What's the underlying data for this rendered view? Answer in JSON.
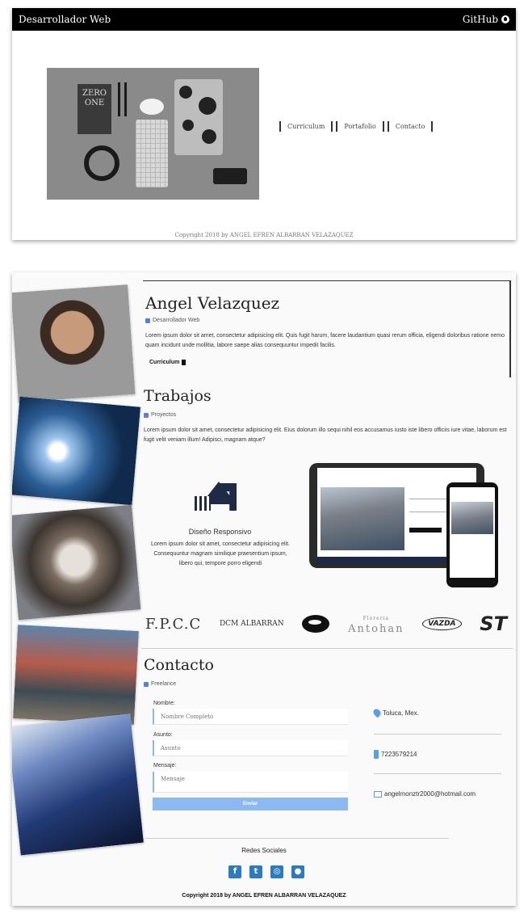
{
  "card1": {
    "brand": "Desarrollador Web",
    "github_label": "GitHub",
    "menu": [
      "Curriculum",
      "Portafolio",
      "Contacto"
    ],
    "hero_book_text": "ZERO\nONE",
    "copyright": "Copyright 2018 by ANGEL EFREN ALBARRAN VELAZAQUEZ"
  },
  "profile": {
    "name": "Angel Velazquez",
    "role": "Desarrollador Web",
    "bio": "Lorem ipsum dolor sit amet, consectetur adipisicing elit. Quis fugit harum, facere laudantium quasi rerum officia, eligendi doloribus ratione nemo quam incidunt unde mollitia, labore saepe alias consequuntur impedit facilis.",
    "cv_label": "Curriculum"
  },
  "work": {
    "title": "Trabajos",
    "subtitle": "Proyectos",
    "text": "Lorem ipsum dolor sit amet, consectetur adipisicing elit. Eius dolorum illo sequi nihil eos accusamus iusto iste libero officiis iure vitae, laborum est fugit velit veniam illum! Adipisci, magnam atque?",
    "feature_title": "Diseño Responsivo",
    "feature_text": "Lorem ipsum dolor sit amet, consectetur adipisicing elit. Consequuntur magnam similique praesentium ipsum, libero qui, tempore porro eligendi",
    "clients": [
      "F.P.C.C",
      "DCM ALBARRAN",
      "",
      "Antohan",
      "VAZDA",
      "ST"
    ],
    "client4_small": "Floreria"
  },
  "contact": {
    "title": "Contacto",
    "subtitle": "Freelance",
    "name_label": "Nombre:",
    "name_placeholder": "Nombre Completo",
    "subject_label": "Asunto:",
    "subject_placeholder": "Asunto",
    "message_label": "Mensaje:",
    "message_placeholder": "Mensaje",
    "send_label": "Enviar",
    "location": "Toluca, Mex.",
    "phone": "7223579214",
    "email": "angelmonztr2000@hotmail.com"
  },
  "footer": {
    "social_title": "Redes Sociales",
    "social": [
      "facebook-icon",
      "twitter-icon",
      "instagram-icon",
      "github-icon"
    ],
    "copyright": "Copyright 2018 by ANGEL EFREN ALBARRAN VELAZAQUEZ"
  },
  "colors": {
    "accent": "#8db9f3",
    "social": "#2b7bbf",
    "nav": "#000000"
  }
}
